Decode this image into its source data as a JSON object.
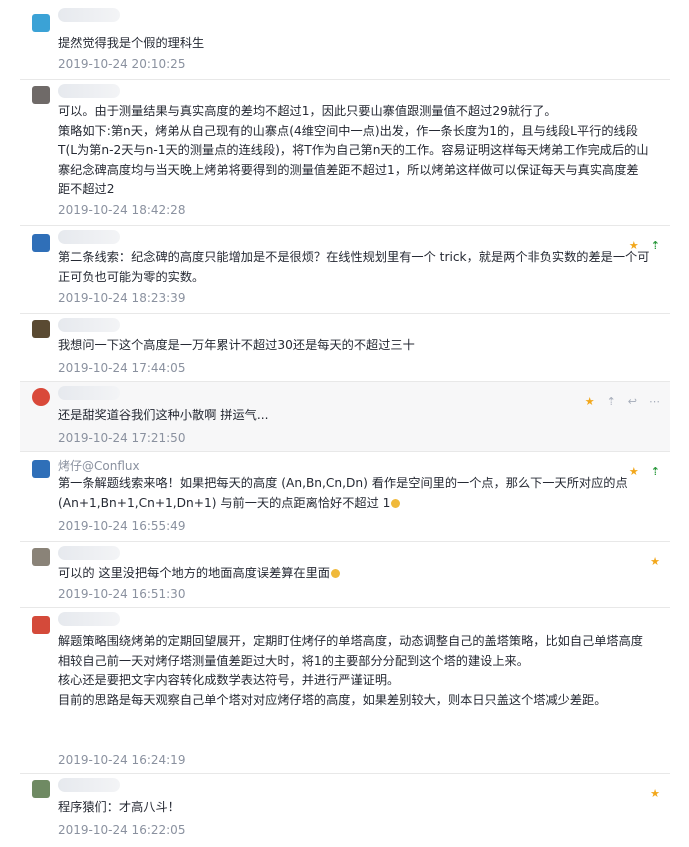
{
  "comments": [
    {
      "user": "",
      "body": [
        "提然觉得我是个假的理科生"
      ],
      "time": "2019-10-24 20:10:25",
      "avatar_color": "#3ba2d6"
    },
    {
      "user": "",
      "body": [
        "可以。由于测量结果与真实高度的差均不超过1，因此只要山寨值跟测量值不超过29就行了。",
        "策略如下:第n天，烤弟从自己现有的山寨点(4维空间中一点)出发，作一条长度为1的，且与线段L平行的线段T(L为第n-2天与n-1天的测量点的连线段)，将T作为自己第n天的工作。容易证明这样每天烤弟工作完成后的山寨纪念碑高度均与当天晚上烤弟将要得到的测量值差距不超过1，所以烤弟这样做可以保证每天与真实高度差距不超过2"
      ],
      "time": "2019-10-24 18:42:28",
      "avatar_color": "#6f6a68"
    },
    {
      "user": "",
      "body": [
        "第二条线索：纪念碑的高度只能增加是不是很烦？在线性规划里有一个 trick，就是两个非负实数的差是一个可正可负也可能为零的实数。"
      ],
      "time": "2019-10-24 18:23:39",
      "avatar_color": "#2f6fb8"
    },
    {
      "user": "",
      "body": [
        "我想问一下这个高度是一万年累计不超过30还是每天的不超过三十"
      ],
      "time": "2019-10-24 17:44:05",
      "avatar_color": "#5a4a32"
    },
    {
      "user": "",
      "body": [
        "还是甜奖道谷我们这种小散啊 拼运气..."
      ],
      "time": "2019-10-24 17:21:50",
      "avatar_color": "#d9493a"
    },
    {
      "user": "烤仔@Conflux",
      "body": [
        "第一条解题线索来咯！如果把每天的高度 (An,Bn,Cn,Dn) 看作是空间里的一个点，那么下一天所对应的点 (An+1,Bn+1,Cn+1,Dn+1) 与前一天的点距离恰好不超过 1"
      ],
      "time": "2019-10-24 16:55:49",
      "avatar_color": "#2f6fb8"
    },
    {
      "user": "",
      "body": [
        "可以的 这里没把每个地方的地面高度误差算在里面"
      ],
      "time": "2019-10-24 16:51:30",
      "avatar_color": "#8a8378"
    },
    {
      "user": "",
      "body": [
        "解题策略围绕烤弟的定期回望展开，定期盯住烤仔的单塔高度，动态调整自己的盖塔策略，比如自己单塔高度相较自己前一天对烤仔塔测量值差距过大时，将1的主要部分分配到这个塔的建设上来。",
        "核心还是要把文字内容转化成数学表达符号，并进行严谨证明。",
        "目前的思路是每天观察自己单个塔对对应烤仔塔的高度，如果差别较大，则本日只盖这个塔减少差距。"
      ],
      "time": "2019-10-24 16:24:19",
      "avatar_color": "#d44a3a"
    },
    {
      "user": "",
      "body": [
        "程序猿们：才高八斗！"
      ],
      "time": "2019-10-24 16:22:05",
      "avatar_color": "#6f8a63"
    }
  ],
  "icons": {
    "star": "★",
    "up_arrow": "⇡",
    "reply": "↩",
    "more": "⋯"
  },
  "colors": {
    "star": "#f2a71b",
    "up_green": "#2c9a3f",
    "meta": "#8a919f"
  }
}
